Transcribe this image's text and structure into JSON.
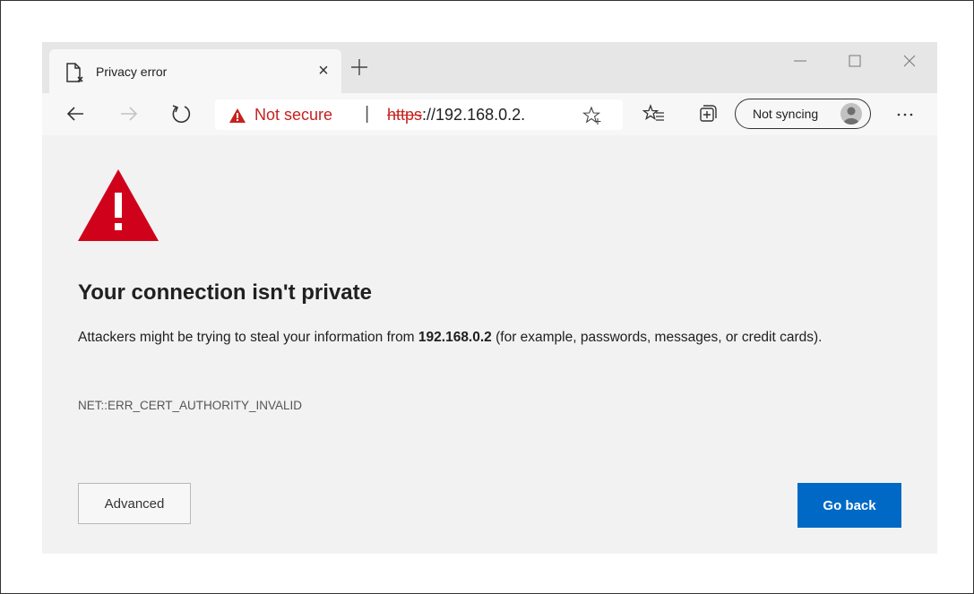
{
  "tab": {
    "title": "Privacy error",
    "close_glyph": "×",
    "icon": "page-error-icon"
  },
  "new_tab_icon": "plus-icon",
  "window_controls": [
    "minimize-icon",
    "maximize-icon",
    "close-icon"
  ],
  "toolbar": {
    "icons": [
      "back-arrow-icon",
      "forward-arrow-icon",
      "refresh-icon",
      "favorites-icon",
      "collections-icon",
      "more-icon"
    ],
    "address": {
      "security_label": "Not secure",
      "separator": "|",
      "url_scheme": "https",
      "url_rest": "://192.168.0.2.",
      "icon": "warning-triangle-icon"
    },
    "sync": {
      "label": "Not syncing"
    },
    "more_glyph": "···"
  },
  "content": {
    "heading": "Your connection isn't private",
    "desc_before": "Attackers might be trying to steal your information from ",
    "desc_host": "192.168.0.2",
    "desc_after": " (for example, passwords, messages, or credit cards).",
    "error_code": "NET::ERR_CERT_AUTHORITY_INVALID",
    "advanced_label": "Advanced",
    "go_back_label": "Go back"
  },
  "colors": {
    "warning_red": "#d0021b",
    "not_secure_red": "#c5221f",
    "primary_blue": "#0069c5",
    "page_bg": "#f2f2f2"
  }
}
